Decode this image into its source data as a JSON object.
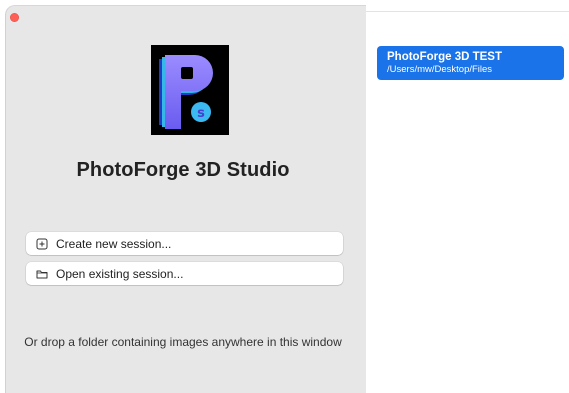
{
  "window": {
    "close_button_color": "#fe5f57"
  },
  "app": {
    "logo_icon": "photoforge-logo-icon",
    "title": "PhotoForge 3D Studio"
  },
  "actions": {
    "create_label": "Create new session...",
    "create_icon": "plus-square-icon",
    "open_label": "Open existing session...",
    "open_icon": "folder-icon"
  },
  "drop_hint": "Or drop a folder containing images anywhere in this window",
  "recent_sessions": [
    {
      "name": "PhotoForge 3D TEST",
      "path": "/Users/mw/Desktop/Files",
      "selected": true
    }
  ],
  "colors": {
    "accent": "#1a73e8",
    "sidebar_bg": "#e8e7e8",
    "logo_bg": "#000000"
  }
}
